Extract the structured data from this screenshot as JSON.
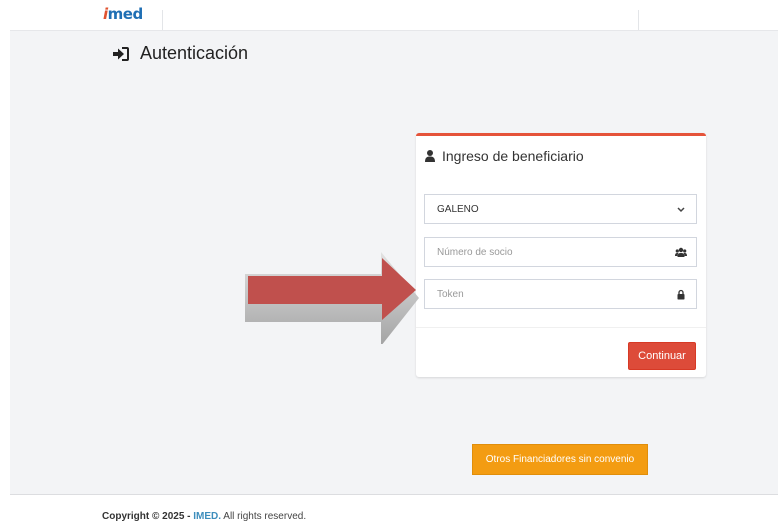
{
  "header": {
    "logo": {
      "accent": "i",
      "rest": "med",
      "accent_color": "#e0522f",
      "brand_color": "#1f6fb4"
    }
  },
  "page": {
    "title": "Autenticación",
    "title_icon": "sign-in-icon"
  },
  "login_card": {
    "title": "Ingreso de beneficiario",
    "title_icon": "user-icon",
    "accent_color": "#e5533a",
    "financier_select": {
      "value": "GALENO",
      "icon": "chevron-down-icon"
    },
    "member_number": {
      "placeholder": "Número de socio",
      "icon": "users-icon"
    },
    "token": {
      "placeholder": "Token",
      "icon": "lock-icon"
    },
    "continue_label": "Continuar",
    "continue_color": "#dd4b39"
  },
  "other_financiers_label": "Otros Financiadores sin convenio",
  "other_financiers_color": "#f39c12",
  "footer": {
    "prefix": "Copyright © 2025 - ",
    "brand": "IMED.",
    "suffix": " All rights reserved."
  },
  "annotation": {
    "type": "arrow",
    "icon": "right-arrow-annotation",
    "color": "#c0504d"
  }
}
